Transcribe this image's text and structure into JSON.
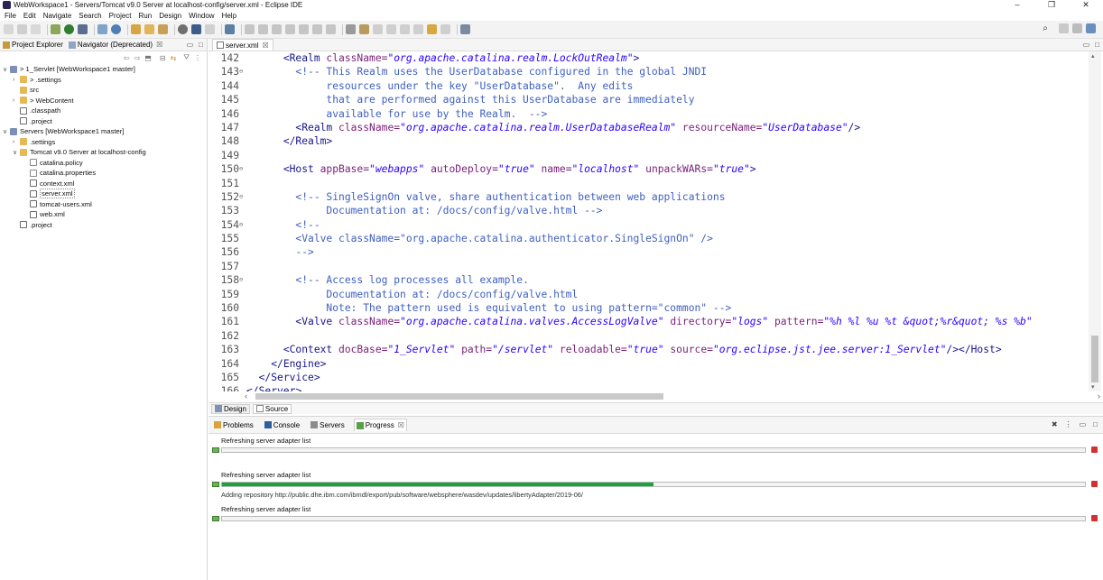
{
  "window": {
    "title": "WebWorkspace1 - Servers/Tomcat v9.0 Server at localhost-config/server.xml - Eclipse IDE",
    "min": "–",
    "max": "❐",
    "close": "✕"
  },
  "menu": [
    "File",
    "Edit",
    "Navigate",
    "Search",
    "Project",
    "Run",
    "Design",
    "Window",
    "Help"
  ],
  "left_panel": {
    "tabs": [
      {
        "label": "Project Explorer",
        "icon": "project-explorer-icon"
      },
      {
        "label": "Navigator (Deprecated)",
        "icon": "navigator-icon",
        "close": "☒"
      }
    ],
    "tree": [
      {
        "depth": 0,
        "twisty": "∨",
        "icon": "proj",
        "label": "> 1_Servlet [WebWorkspace1 master]"
      },
      {
        "depth": 1,
        "twisty": "›",
        "icon": "folder",
        "label": "> .settings"
      },
      {
        "depth": 1,
        "twisty": "",
        "icon": "folder",
        "label": "src"
      },
      {
        "depth": 1,
        "twisty": "›",
        "icon": "folder",
        "label": "> WebContent"
      },
      {
        "depth": 1,
        "twisty": "",
        "icon": "xml",
        "label": ".classpath"
      },
      {
        "depth": 1,
        "twisty": "",
        "icon": "xml",
        "label": ".project"
      },
      {
        "depth": 0,
        "twisty": "∨",
        "icon": "proj",
        "label": "Servers [WebWorkspace1 master]"
      },
      {
        "depth": 1,
        "twisty": "›",
        "icon": "folder",
        "label": ".settings"
      },
      {
        "depth": 1,
        "twisty": "∨",
        "icon": "folder",
        "label": "Tomcat v9.0 Server at localhost-config"
      },
      {
        "depth": 2,
        "twisty": "",
        "icon": "fileic",
        "label": "catalina.policy"
      },
      {
        "depth": 2,
        "twisty": "",
        "icon": "fileic",
        "label": "catalina.properties"
      },
      {
        "depth": 2,
        "twisty": "",
        "icon": "xml",
        "label": "context.xml"
      },
      {
        "depth": 2,
        "twisty": "",
        "icon": "xml",
        "label": "server.xml",
        "selected": true
      },
      {
        "depth": 2,
        "twisty": "",
        "icon": "xml",
        "label": "tomcat-users.xml"
      },
      {
        "depth": 2,
        "twisty": "",
        "icon": "xml",
        "label": "web.xml"
      },
      {
        "depth": 1,
        "twisty": "",
        "icon": "xml",
        "label": ".project"
      }
    ]
  },
  "editor": {
    "tab_label": "server.xml",
    "tab_close": "☒",
    "lines": [
      {
        "n": "142",
        "fold": "",
        "segs": [
          [
            "",
            "      "
          ],
          [
            "tg",
            "<Realm "
          ],
          [
            "an",
            "className="
          ],
          [
            "av",
            "\"org.apache.catalina.realm.LockOutRealm\""
          ],
          [
            "tg",
            ">"
          ]
        ]
      },
      {
        "n": "143",
        "fold": "⊖",
        "segs": [
          [
            "",
            "        "
          ],
          [
            "cm",
            "<!-- This Realm uses the UserDatabase configured in the global JNDI"
          ]
        ]
      },
      {
        "n": "144",
        "fold": "",
        "segs": [
          [
            "cm",
            "             resources under the key \"UserDatabase\".  Any edits"
          ]
        ]
      },
      {
        "n": "145",
        "fold": "",
        "segs": [
          [
            "cm",
            "             that are performed against this UserDatabase are immediately"
          ]
        ]
      },
      {
        "n": "146",
        "fold": "",
        "segs": [
          [
            "cm",
            "             available for use by the Realm.  -->"
          ]
        ]
      },
      {
        "n": "147",
        "fold": "",
        "segs": [
          [
            "",
            "        "
          ],
          [
            "tg",
            "<Realm "
          ],
          [
            "an",
            "className="
          ],
          [
            "av",
            "\"org.apache.catalina.realm.UserDatabaseRealm\""
          ],
          [
            "an",
            " resourceName="
          ],
          [
            "av",
            "\"UserDatabase\""
          ],
          [
            "tg",
            "/>"
          ]
        ]
      },
      {
        "n": "148",
        "fold": "",
        "segs": [
          [
            "",
            "      "
          ],
          [
            "tg",
            "</Realm>"
          ]
        ]
      },
      {
        "n": "149",
        "fold": "",
        "segs": [
          [
            "",
            ""
          ]
        ]
      },
      {
        "n": "150",
        "fold": "⊖",
        "segs": [
          [
            "",
            "      "
          ],
          [
            "tg",
            "<Host "
          ],
          [
            "an",
            "appBase="
          ],
          [
            "av",
            "\"webapps\""
          ],
          [
            "an",
            " autoDeploy="
          ],
          [
            "av",
            "\"true\""
          ],
          [
            "an",
            " name="
          ],
          [
            "av",
            "\"localhost\""
          ],
          [
            "an",
            " unpackWARs="
          ],
          [
            "av",
            "\"true\""
          ],
          [
            "tg",
            ">"
          ]
        ]
      },
      {
        "n": "151",
        "fold": "",
        "segs": [
          [
            "",
            ""
          ]
        ]
      },
      {
        "n": "152",
        "fold": "⊖",
        "segs": [
          [
            "",
            "        "
          ],
          [
            "cm",
            "<!-- SingleSignOn valve, share authentication between web applications"
          ]
        ]
      },
      {
        "n": "153",
        "fold": "",
        "segs": [
          [
            "cm",
            "             Documentation at: /docs/config/valve.html -->"
          ]
        ]
      },
      {
        "n": "154",
        "fold": "⊖",
        "segs": [
          [
            "",
            "        "
          ],
          [
            "cm",
            "<!--"
          ]
        ]
      },
      {
        "n": "155",
        "fold": "",
        "segs": [
          [
            "cm",
            "        <Valve className=\"org.apache.catalina.authenticator.SingleSignOn\" />"
          ]
        ]
      },
      {
        "n": "156",
        "fold": "",
        "segs": [
          [
            "cm",
            "        -->"
          ]
        ]
      },
      {
        "n": "157",
        "fold": "",
        "segs": [
          [
            "",
            ""
          ]
        ]
      },
      {
        "n": "158",
        "fold": "⊖",
        "segs": [
          [
            "",
            "        "
          ],
          [
            "cm",
            "<!-- Access log processes all example."
          ]
        ]
      },
      {
        "n": "159",
        "fold": "",
        "segs": [
          [
            "cm",
            "             Documentation at: /docs/config/valve.html"
          ]
        ]
      },
      {
        "n": "160",
        "fold": "",
        "segs": [
          [
            "cm",
            "             Note: The pattern used is equivalent to using pattern=\"common\" -->"
          ]
        ]
      },
      {
        "n": "161",
        "fold": "",
        "segs": [
          [
            "",
            "        "
          ],
          [
            "tg",
            "<Valve "
          ],
          [
            "an",
            "className="
          ],
          [
            "av",
            "\"org.apache.catalina.valves.AccessLogValve\""
          ],
          [
            "an",
            " directory="
          ],
          [
            "av",
            "\"logs\""
          ],
          [
            "an",
            " pattern="
          ],
          [
            "av",
            "\"%h %l %u %t &quot;%r&quot; %s %b\""
          ]
        ]
      },
      {
        "n": "162",
        "fold": "",
        "segs": [
          [
            "",
            ""
          ]
        ]
      },
      {
        "n": "163",
        "fold": "",
        "segs": [
          [
            "",
            "      "
          ],
          [
            "tg",
            "<Context "
          ],
          [
            "an",
            "docBase="
          ],
          [
            "av",
            "\"1_Servlet\""
          ],
          [
            "an",
            " path="
          ],
          [
            "av",
            "\"/servlet\""
          ],
          [
            "an",
            " reloadable="
          ],
          [
            "av",
            "\"true\""
          ],
          [
            "an",
            " source="
          ],
          [
            "av",
            "\"org.eclipse.jst.jee.server:1_Servlet\""
          ],
          [
            "tg",
            "/></Host>"
          ]
        ]
      },
      {
        "n": "164",
        "fold": "",
        "segs": [
          [
            "",
            "    "
          ],
          [
            "tg",
            "</Engine>"
          ]
        ]
      },
      {
        "n": "165",
        "fold": "",
        "segs": [
          [
            "",
            "  "
          ],
          [
            "tg",
            "</Service>"
          ]
        ]
      },
      {
        "n": "166",
        "fold": "",
        "segs": [
          [
            "tg",
            "</Server>"
          ]
        ]
      }
    ],
    "design_tabs": [
      {
        "label": "Design",
        "active": false
      },
      {
        "label": "Source",
        "active": true
      }
    ]
  },
  "bottom_panel": {
    "tabs": [
      {
        "label": "Problems",
        "icon": "problems-icon"
      },
      {
        "label": "Console",
        "icon": "console-icon"
      },
      {
        "label": "Servers",
        "icon": "servers-icon"
      },
      {
        "label": "Progress",
        "icon": "progress-icon",
        "active": true,
        "close": "☒"
      }
    ],
    "progress": [
      {
        "label": "Refreshing server adapter list",
        "fraction": 0.0,
        "detail": ""
      },
      {
        "label": "Refreshing server adapter list",
        "fraction": 0.5,
        "detail": "Adding repository http://public.dhe.ibm.com/ibmdl/export/pub/software/websphere/wasdev/updates/libertyAdapter/2019-06/"
      },
      {
        "label": "Refreshing server adapter list",
        "fraction": 0.0,
        "detail": ""
      }
    ]
  },
  "colors": {
    "progress_fill": "#1aa33a",
    "stop": "#d33030",
    "tag": "#17168b",
    "attr_name": "#7a1f7a",
    "attr_value": "#2a00ff",
    "comment": "#3f5fbf"
  }
}
